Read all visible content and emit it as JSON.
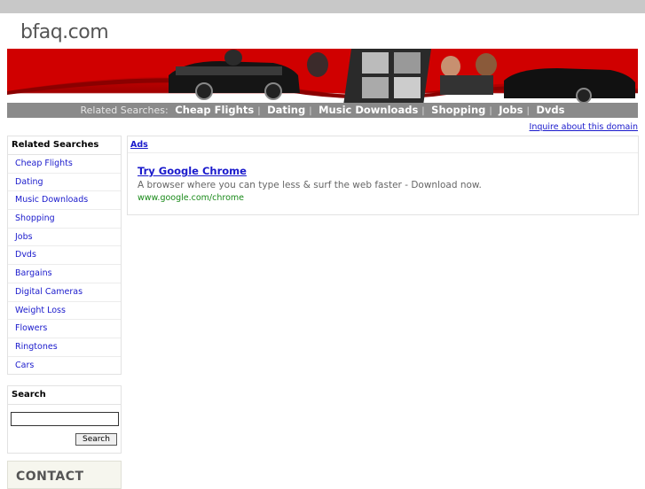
{
  "site": {
    "title": "bfaq.com"
  },
  "related_bar": {
    "label": "Related Searches:",
    "links": [
      "Cheap Flights",
      "Dating",
      "Music Downloads",
      "Shopping",
      "Jobs",
      "Dvds"
    ],
    "separator": "|"
  },
  "inquire": {
    "text": "Inquire about this domain"
  },
  "sidebar": {
    "related_title": "Related Searches",
    "items": [
      "Cheap Flights",
      "Dating",
      "Music Downloads",
      "Shopping",
      "Jobs",
      "Dvds",
      "Bargains",
      "Digital Cameras",
      "Weight Loss",
      "Flowers",
      "Ringtones",
      "Cars"
    ],
    "search_title": "Search",
    "search_value": "",
    "search_button": "Search",
    "contact": "CONTACT"
  },
  "ads": {
    "label": "Ads",
    "items": [
      {
        "title": "Try Google Chrome",
        "description": "A browser where you can type less & surf the web faster - Download now.",
        "url": "www.google.com/chrome"
      }
    ]
  },
  "colors": {
    "link": "#1a1acc",
    "banner_red": "#c00000",
    "relbar_gray": "#8a8a8a",
    "ad_url_green": "#1a8a1a"
  }
}
